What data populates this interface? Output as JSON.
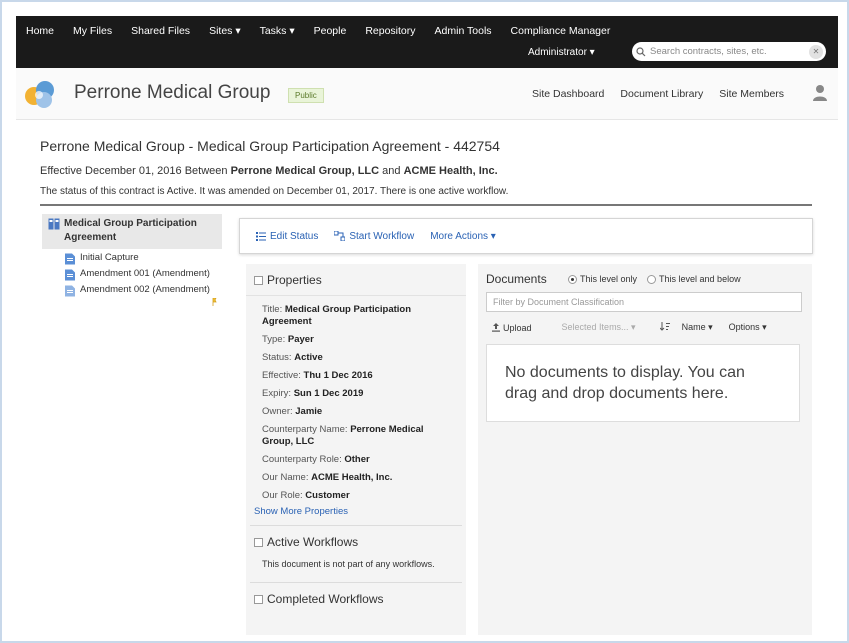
{
  "nav": {
    "menu": [
      "Home",
      "My Files",
      "Shared Files",
      "Sites ▾",
      "Tasks ▾",
      "People",
      "Repository",
      "Admin Tools",
      "Compliance Manager"
    ],
    "user": "Administrator ▾",
    "search_placeholder": "Search contracts, sites, etc."
  },
  "site": {
    "name": "Perrone Medical Group",
    "badge": "Public",
    "links": [
      "Site Dashboard",
      "Document Library",
      "Site Members"
    ]
  },
  "contract": {
    "title": "Perrone Medical Group - Medical Group Participation Agreement - 442754",
    "eff_prefix": "Effective December 01, 2016 Between ",
    "party1": "Perrone Medical Group, LLC",
    "eff_and": " and ",
    "party2": "ACME Health, Inc.",
    "status_line": "The status of this contract is Active. It was amended on December 01, 2017. There is one active workflow."
  },
  "tree": {
    "root": "Medical Group Participation Agreement",
    "nodes": [
      "Initial Capture",
      "Amendment 001 (Amendment)",
      "Amendment 002 (Amendment)"
    ]
  },
  "actions": {
    "edit_status": "Edit Status",
    "start_workflow": "Start Workflow",
    "more_actions": "More Actions ▾"
  },
  "properties": {
    "heading": "Properties",
    "items": [
      {
        "label": "Title:",
        "value": "Medical Group Participation Agreement"
      },
      {
        "label": "Type:",
        "value": "Payer"
      },
      {
        "label": "Status:",
        "value": "Active"
      },
      {
        "label": "Effective:",
        "value": "Thu 1 Dec 2016"
      },
      {
        "label": "Expiry:",
        "value": "Sun 1 Dec 2019"
      },
      {
        "label": "Owner:",
        "value": "Jamie"
      },
      {
        "label": "Counterparty Name:",
        "value": "Perrone Medical Group, LLC"
      },
      {
        "label": "Counterparty Role:",
        "value": "Other"
      },
      {
        "label": "Our Name:",
        "value": "ACME Health, Inc."
      },
      {
        "label": "Our Role:",
        "value": "Customer"
      }
    ],
    "show_more": "Show More Properties"
  },
  "workflows": {
    "active_heading": "Active Workflows",
    "active_text": "This document is not part of any workflows.",
    "completed_heading": "Completed Workflows"
  },
  "documents": {
    "heading": "Documents",
    "radio1": "This level only",
    "radio2": "This level and below",
    "filter_placeholder": "Filter by Document Classification",
    "upload": "Upload",
    "selected_items": "Selected Items... ▾",
    "name_sort": "Name ▾",
    "options": "Options ▾",
    "empty": "No documents to display. You can drag and drop documents here."
  },
  "colors": {
    "nav_bg": "#1a1a1a",
    "link": "#2a62b4",
    "panel_bg": "#f4f4f4"
  }
}
